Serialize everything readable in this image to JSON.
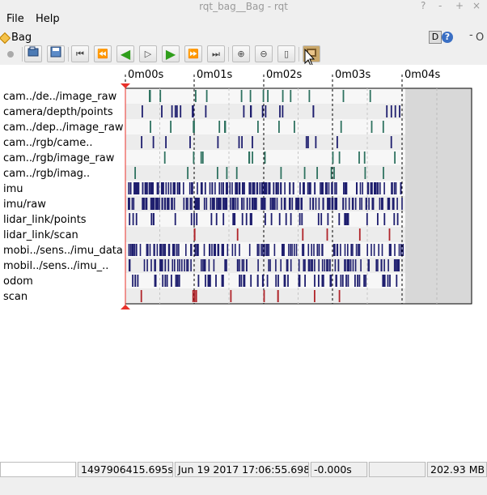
{
  "window": {
    "title": "rqt_bag__Bag - rqt",
    "controls": [
      "?",
      "-",
      "+",
      "×"
    ]
  },
  "menubar": {
    "file": "File",
    "help": "Help"
  },
  "dock": {
    "title": "Bag",
    "d_label": "D",
    "help_label": "?",
    "o_label": "O"
  },
  "toolbar": {
    "buttons": [
      "record",
      "load",
      "save",
      "begin",
      "rewind",
      "previous",
      "play",
      "next",
      "fastforward",
      "end",
      "zoom-in",
      "zoom-out",
      "zoom-fit",
      "thumbnails"
    ]
  },
  "timeline": {
    "tick_labels": [
      "0m00s",
      "0m01s",
      "0m02s",
      "0m03s",
      "0m04s"
    ],
    "topics": [
      "cam../de../image_raw",
      "camera/depth/points",
      "cam../dep../image_raw",
      "cam../rgb/came..",
      "cam../rgb/image_raw",
      "cam../rgb/imag..",
      "imu",
      "imu/raw",
      "lidar_link/points",
      "lidar_link/scan",
      "mobi../sens../imu_data",
      "mobil../sens../imu_..",
      "odom",
      "scan"
    ],
    "colors": {
      "image": "#2f7260",
      "points": "#1e1e6e",
      "scan": "#b0242a",
      "playhead": "#e8302a"
    }
  },
  "statusbar": {
    "field_blank": "",
    "timestamp": "1497906415.695s",
    "datetime": "Jun 19 2017 17:06:55.698",
    "offset": "-0.000s",
    "field_empty": "",
    "size": "202.93 MB"
  }
}
